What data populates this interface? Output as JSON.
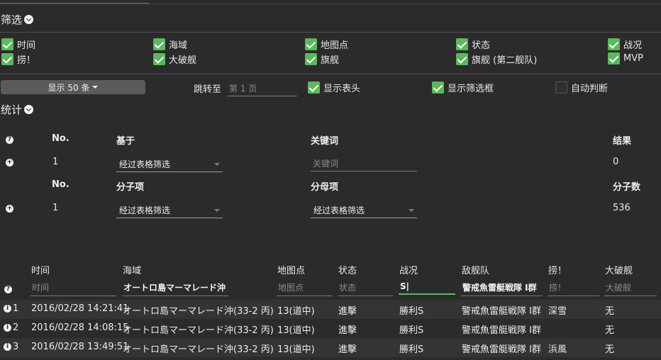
{
  "filter": {
    "title": "筛选",
    "checkboxes": [
      {
        "label": "时间",
        "checked": true
      },
      {
        "label": "海域",
        "checked": true
      },
      {
        "label": "地图点",
        "checked": true
      },
      {
        "label": "状态",
        "checked": true
      },
      {
        "label": "战况",
        "checked": true
      },
      {
        "label": "捞！",
        "checked": true
      },
      {
        "label": "大破舰",
        "checked": true
      },
      {
        "label": "旗舰",
        "checked": true
      },
      {
        "label": "旗舰 (第二舰队)",
        "checked": true
      },
      {
        "label": "MVP",
        "checked": true
      }
    ],
    "show_button": "显示 50 条",
    "jump_label": "跳转至",
    "jump_placeholder": "第 1 页",
    "show_header": "显示表头",
    "show_filter": "显示筛选框",
    "auto_judge": "自动判断"
  },
  "stats": {
    "title": "统计",
    "header1": {
      "no": "No.",
      "base": "基于",
      "keyword": "关键词",
      "result": "结果"
    },
    "row1": {
      "no": "1",
      "base": "经过表格筛选",
      "keyword_placeholder": "关键词",
      "result": "0"
    },
    "header2": {
      "no": "No.",
      "numerator": "分子项",
      "denominator": "分母项",
      "fraction": "分子数"
    },
    "row2": {
      "no": "1",
      "numerator": "经过表格筛选",
      "denominator": "经过表格筛选",
      "fraction": "536"
    }
  },
  "table": {
    "columns": [
      "时间",
      "海域",
      "地图点",
      "状态",
      "战况",
      "敌舰队",
      "捞！",
      "大破舰"
    ],
    "filters": [
      "时间",
      "オートロ島マーマレード沖",
      "地图点",
      "状态",
      "S|",
      "警戒魚雷艇戦隊 I群",
      "捞！",
      "大破舰"
    ],
    "rows": [
      {
        "idx": "1",
        "time": "2016/02/28 14:21:41",
        "area": "オートロ島マーマレード沖(33-2 丙)",
        "point": "13(道中)",
        "status": "進擊",
        "result": "勝利S",
        "enemy": "警戒魚雷艇戦隊 I群",
        "drop": "深雪",
        "damaged": "无"
      },
      {
        "idx": "2",
        "time": "2016/02/28 14:08:15",
        "area": "オートロ島マーマレード沖(33-2 丙)",
        "point": "13(道中)",
        "status": "進擊",
        "result": "勝利S",
        "enemy": "警戒魚雷艇戦隊 I群",
        "drop": "",
        "damaged": "无"
      },
      {
        "idx": "3",
        "time": "2016/02/28 13:49:51",
        "area": "オートロ島マーマレード沖(33-2 丙)",
        "point": "13(道中)",
        "status": "進擊",
        "result": "勝利S",
        "enemy": "警戒魚雷艇戦隊 I群",
        "drop": "浜風",
        "damaged": "无"
      }
    ]
  },
  "colors": {
    "accent": "#5cb85c",
    "background": "#2b2b2b"
  }
}
